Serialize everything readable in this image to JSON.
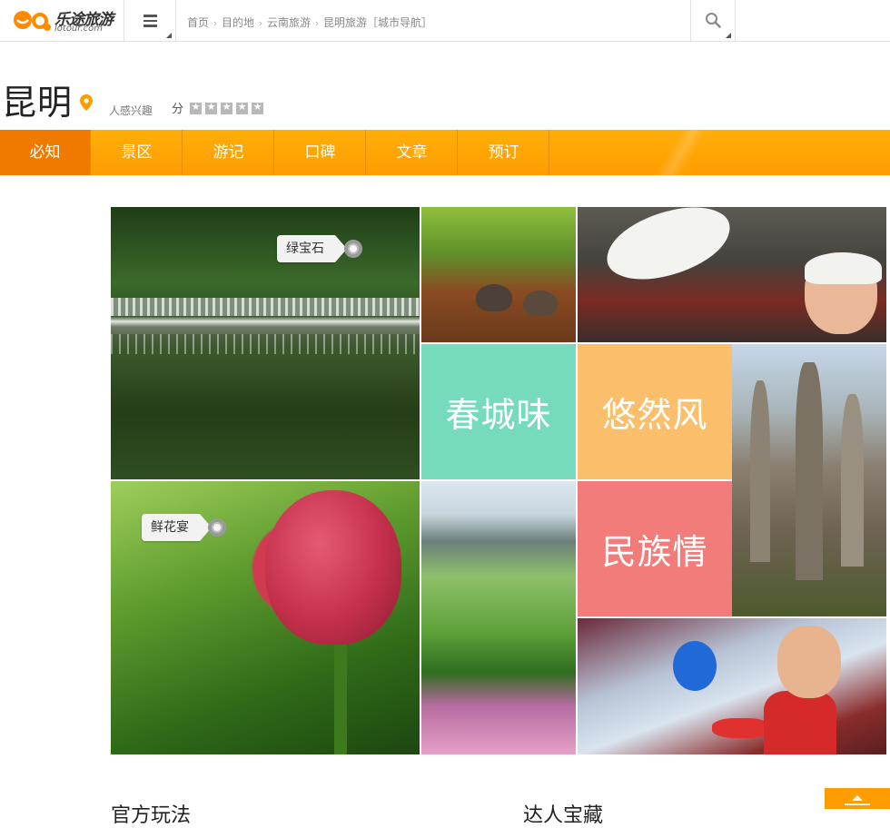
{
  "topbar": {
    "logo_cn": "乐途旅游",
    "logo_en": "lotour.com",
    "menu_icon": "hamburger-icon",
    "search_icon": "search-icon",
    "breadcrumb": [
      "首页",
      "目的地",
      "云南旅游",
      "昆明旅游［城市导航］"
    ]
  },
  "city": {
    "name": "昆明",
    "interest_label": "人感兴趣",
    "score_label": "分",
    "stars": 5,
    "location_icon": "map-pin-icon"
  },
  "nav": {
    "items": [
      "必知",
      "景区",
      "游记",
      "口碑",
      "文章",
      "预订"
    ],
    "active_index": 0,
    "active_color": "#f07a00",
    "bar_color": "#ffa300"
  },
  "mosaic": {
    "tags": [
      "绿宝石",
      "鲜花宴"
    ],
    "tiles": [
      "春城味",
      "悠然风",
      "民族情"
    ],
    "tile_colors": [
      "#75dbbc",
      "#fbbf6b",
      "#f27c7a"
    ]
  },
  "sections": {
    "left_title": "官方玩法",
    "right_title": "达人宝藏"
  },
  "back_to_top_icon": "arrow-up-icon"
}
